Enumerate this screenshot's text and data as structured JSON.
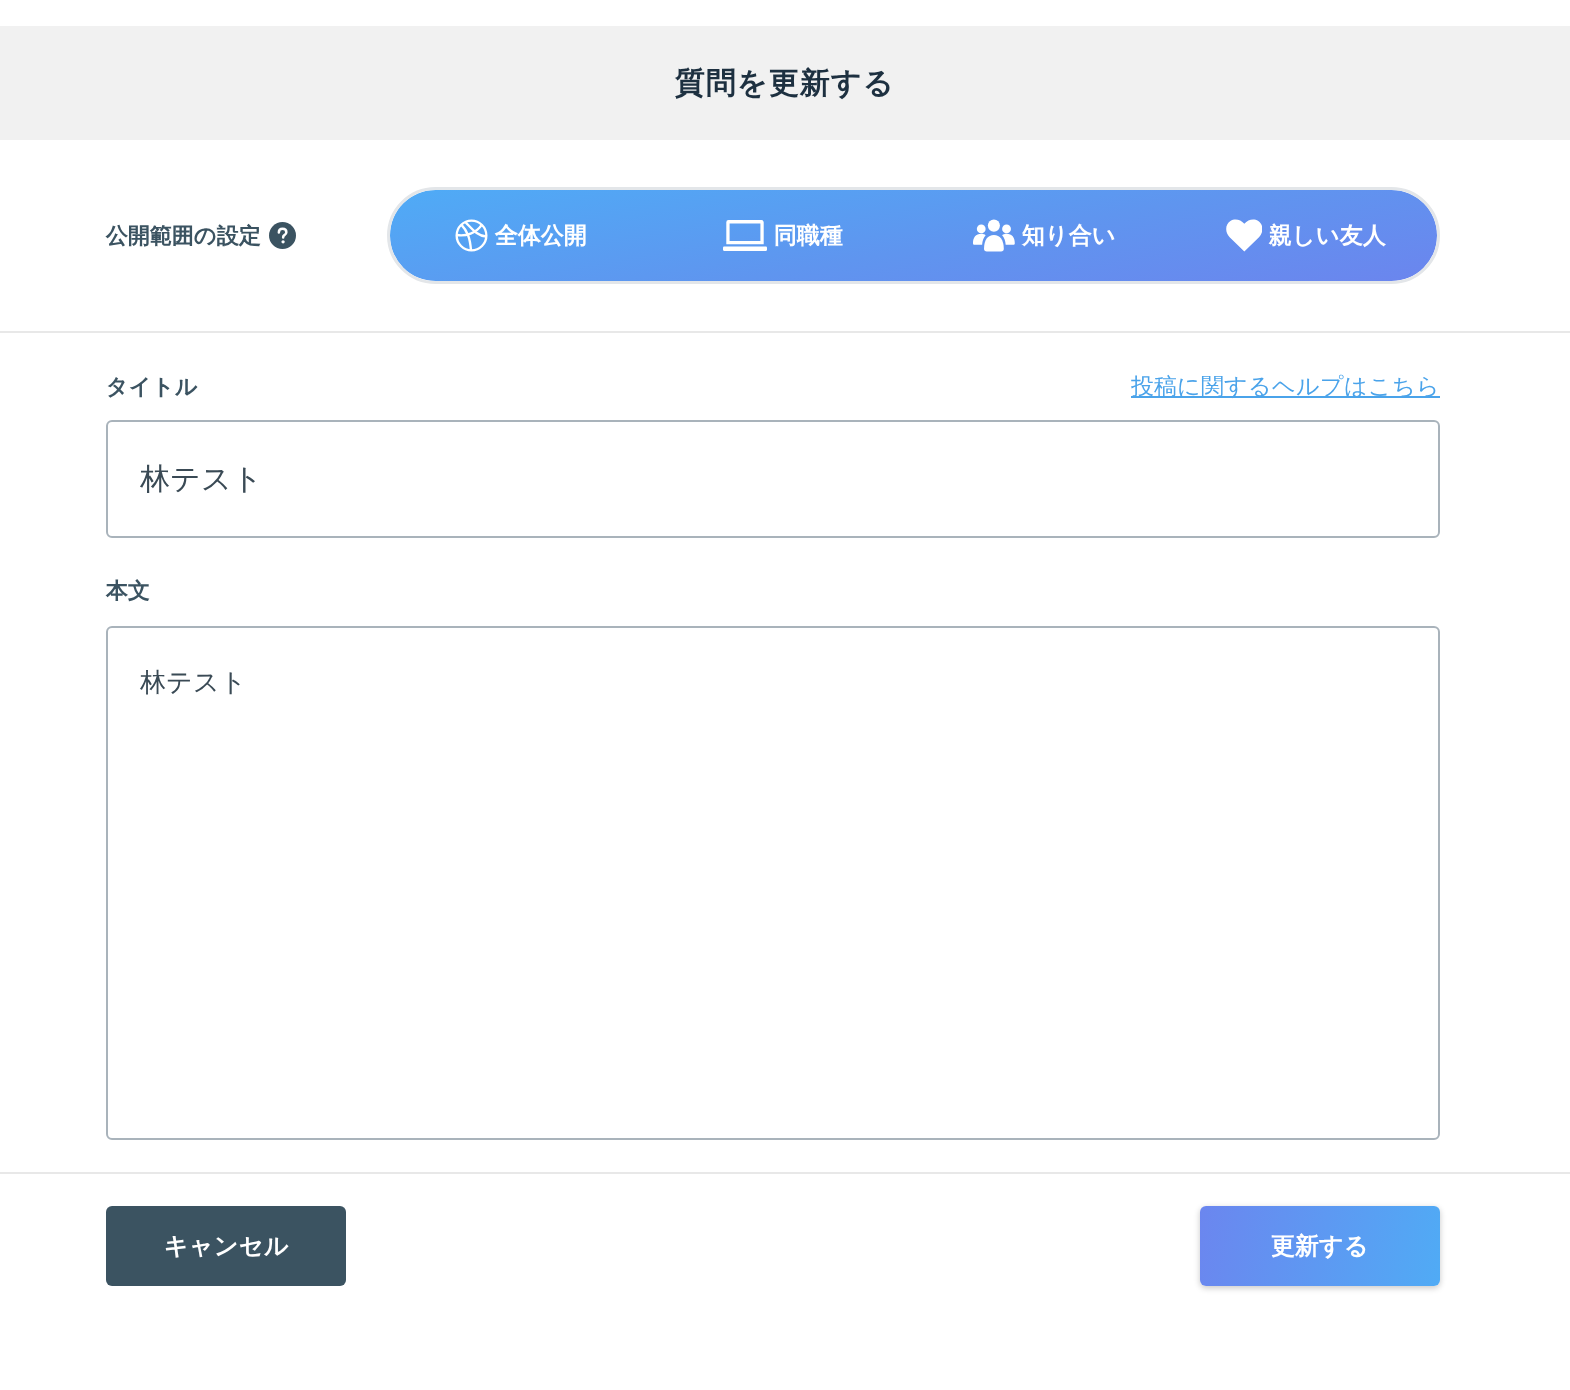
{
  "header": {
    "title": "質問を更新する"
  },
  "visibility": {
    "label": "公開範囲の設定",
    "options": [
      {
        "label": "全体公開",
        "selected": true
      },
      {
        "label": "同職種",
        "selected": true
      },
      {
        "label": "知り合い",
        "selected": true
      },
      {
        "label": "親しい友人",
        "selected": true
      }
    ]
  },
  "title_field": {
    "label": "タイトル",
    "value": "林テスト",
    "help_link": "投稿に関するヘルプはこちら"
  },
  "body_field": {
    "label": "本文",
    "value": "林テスト"
  },
  "buttons": [
    {
      "label": "キャンセル",
      "kind": "secondary"
    },
    {
      "label": "更新する",
      "kind": "primary"
    }
  ]
}
